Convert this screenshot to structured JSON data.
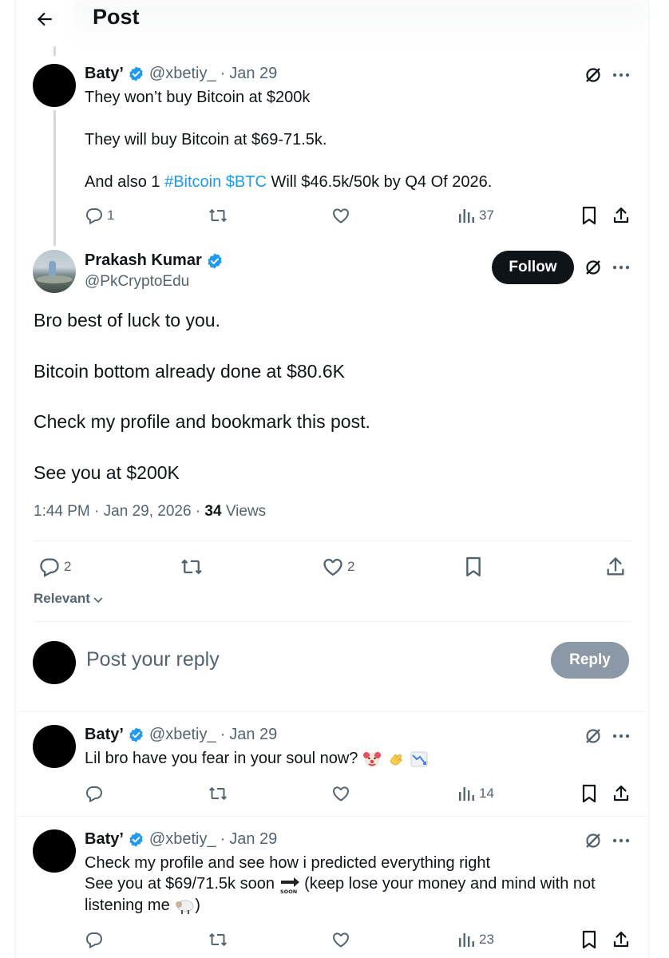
{
  "header": {
    "title": "Post"
  },
  "parent_post": {
    "author_name": "Baty’",
    "handle": "@xbetiy_",
    "date": "Jan 29",
    "line1": "They won’t buy Bitcoin at $200k",
    "line2": "They will buy Bitcoin at $69-71.5k.",
    "line3_prefix": "And also 1 ",
    "line3_tag1": "#Bitcoin",
    "line3_tag2": "$BTC",
    "line3_suffix": " Will $46.5k/50k by Q4 Of 2026.",
    "replies": "1",
    "views": "37"
  },
  "main_post": {
    "author_name": "Prakash Kumar",
    "handle": "@PkCryptoEdu",
    "follow_label": "Follow",
    "text1": "Bro best of luck to you.",
    "text2": "Bitcoin bottom already done at $80.6K",
    "text3": "Check my profile and bookmark this post.",
    "text4": "See you at $200K",
    "time": "1:44 PM",
    "date": "Jan 29, 2026",
    "views_count": "34",
    "views_label": "Views",
    "replies": "2",
    "likes": "2",
    "sort_label": "Relevant"
  },
  "composer": {
    "placeholder": "Post your reply",
    "reply_label": "Reply"
  },
  "reply1": {
    "author_name": "Baty’",
    "handle": "@xbetiy_",
    "date": "Jan 29",
    "text": "Lil bro have you fear in your soul now? ",
    "views": "14"
  },
  "reply2": {
    "author_name": "Baty’",
    "handle": "@xbetiy_",
    "date": "Jan 29",
    "line1": "Check my profile and see how i predicted everything right",
    "line2_a": "See you at $69/71.5k soon ",
    "line2_b": " (keep lose your money and mind with not",
    "line3": "listening me ",
    "line3_end": ")",
    "views": "23"
  },
  "colors": {
    "link": "#1d9bf0",
    "verified": "#1d9bf0",
    "muted": "#536471",
    "reply_button": "#8b98a5"
  },
  "icons": [
    "back-arrow-icon",
    "verified-badge-icon",
    "grok-icon",
    "more-icon",
    "reply-icon",
    "repost-icon",
    "like-icon",
    "views-icon",
    "bookmark-icon",
    "share-icon",
    "chevron-down-icon",
    "clown-emoji-icon",
    "clapping-hands-emoji-icon",
    "chart-decreasing-emoji-icon",
    "soon-arrow-emoji-icon",
    "sheep-emoji-icon"
  ]
}
